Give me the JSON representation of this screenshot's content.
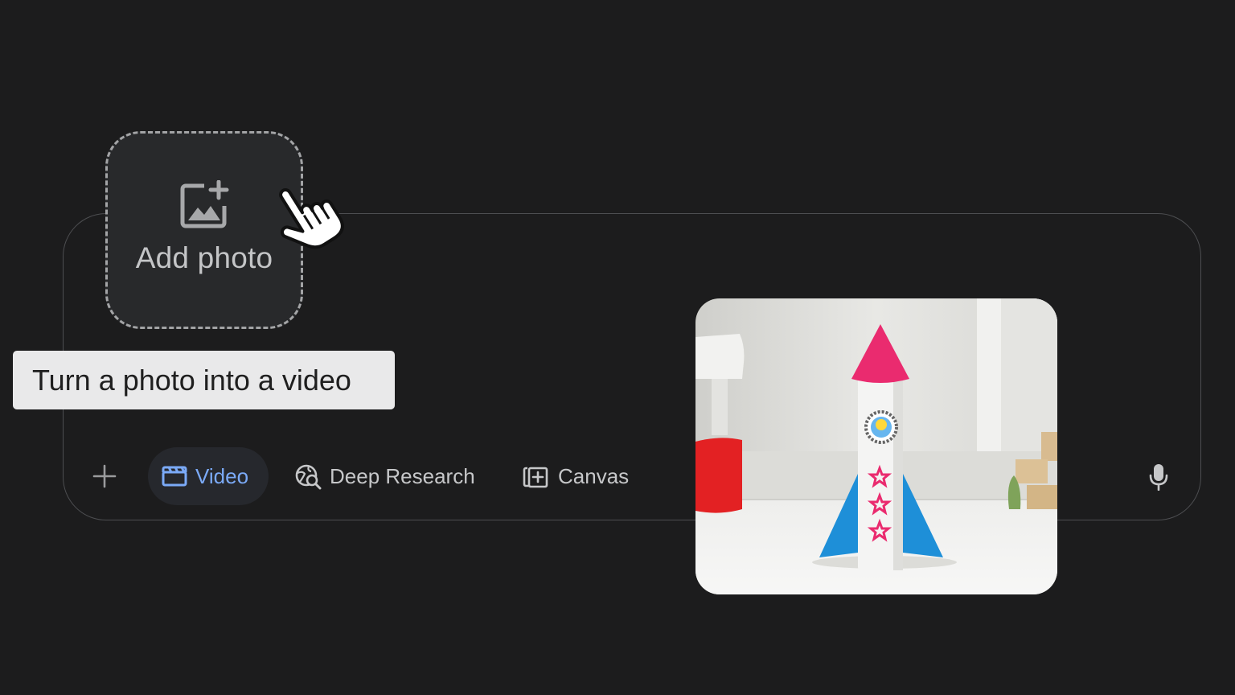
{
  "upload_tile": {
    "label": "Add photo",
    "icon": "add-photo-icon"
  },
  "tooltip": {
    "text": "Turn a photo into a video"
  },
  "toolbar": {
    "plus_icon": "plus-icon",
    "tools": [
      {
        "label": "Video",
        "icon": "clapperboard-icon",
        "selected": true
      },
      {
        "label": "Deep Research",
        "icon": "globe-search-icon",
        "selected": false
      },
      {
        "label": "Canvas",
        "icon": "canvas-add-icon",
        "selected": false
      }
    ],
    "mic_icon": "microphone-icon"
  },
  "preview": {
    "content": "photo of a paper-tube toy rocket on a table"
  },
  "colors": {
    "background": "#1c1c1d",
    "accent_blue": "#7baaf7",
    "chip_selected_bg": "#26282d",
    "tooltip_bg": "#e9e9ea",
    "rocket_pink": "#ea2b6f",
    "rocket_blue": "#1e8fd8"
  }
}
